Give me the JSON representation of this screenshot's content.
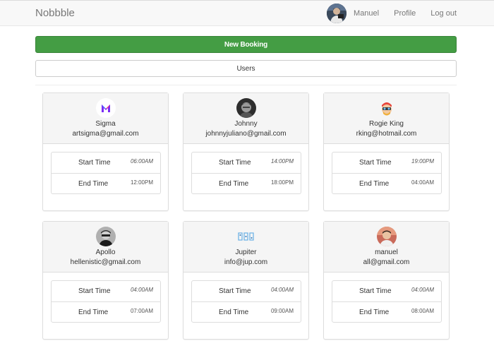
{
  "nav": {
    "brand": "Nobbble",
    "user_name": "Manuel",
    "profile_label": "Profile",
    "logout_label": "Log out"
  },
  "actions": {
    "new_booking_label": "New Booking",
    "users_label": "Users"
  },
  "time_labels": {
    "start": "Start Time",
    "end": "End Time"
  },
  "colors": {
    "success": "#449d44",
    "navbar_bg": "#f8f8f8",
    "panel_head_bg": "#f5f5f5"
  },
  "users": [
    {
      "name": "Sigma",
      "email": "artsigma@gmail.com",
      "start": "06:00AM",
      "end": "12:00PM",
      "avatar": "sigma-logo-icon"
    },
    {
      "name": "Johnny",
      "email": "johnnyjuliano@gmail.com",
      "start": "14:00PM",
      "end": "18:00PM",
      "avatar": "photo-avatar"
    },
    {
      "name": "Rogie King",
      "email": "rking@hotmail.com",
      "start": "19:00PM",
      "end": "04:00AM",
      "avatar": "illustrated-avatar"
    },
    {
      "name": "Apollo",
      "email": "hellenistic@gmail.com",
      "start": "04:00AM",
      "end": "07:00AM",
      "avatar": "photo-avatar"
    },
    {
      "name": "Jupiter",
      "email": "info@jup.com",
      "start": "04:00AM",
      "end": "09:00AM",
      "avatar": "jupiter-logo-icon"
    },
    {
      "name": "manuel",
      "email": "all@gmail.com",
      "start": "04:00AM",
      "end": "08:00AM",
      "avatar": "photo-avatar"
    }
  ]
}
